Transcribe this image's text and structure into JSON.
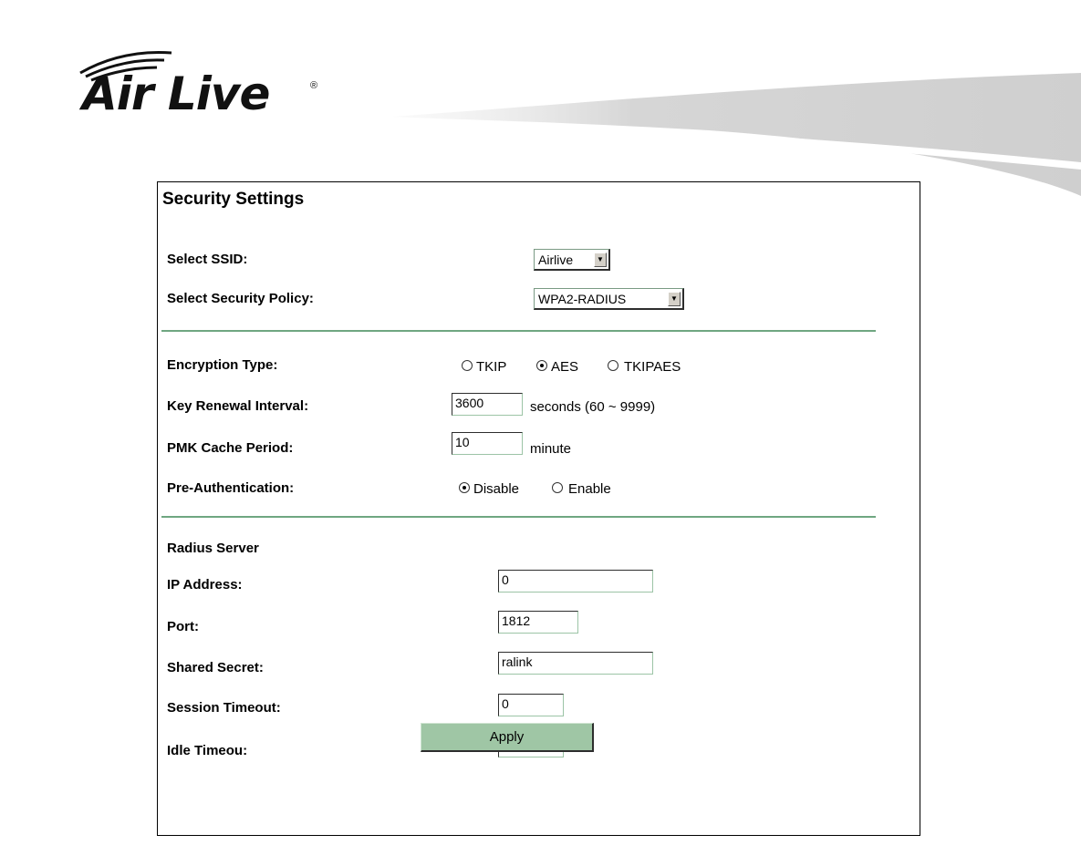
{
  "brand": {
    "logo_text": "Air Live",
    "registered_mark": "®",
    "accent_color": "#6fa681",
    "button_color": "#9fc6a5"
  },
  "panel": {
    "title": "Security Settings"
  },
  "ssid": {
    "label": "Select SSID:",
    "value": "Airlive"
  },
  "policy": {
    "label": "Select Security Policy:",
    "value": "WPA2-RADIUS"
  },
  "encryption": {
    "label": "Encryption Type:",
    "options": [
      "TKIP",
      "AES",
      "TKIPAES"
    ],
    "selected": "AES"
  },
  "key_renewal": {
    "label": "Key Renewal Interval:",
    "value": "3600",
    "unit": "seconds  (60 ~ 9999)"
  },
  "pmk_cache": {
    "label": "PMK Cache Period:",
    "value": "10",
    "unit": "minute"
  },
  "pre_auth": {
    "label": "Pre-Authentication:",
    "options": [
      "Disable",
      "Enable"
    ],
    "selected": "Disable"
  },
  "radius": {
    "section_label": "Radius Server",
    "ip_label": "IP Address:",
    "ip_value": "0",
    "port_label": "Port:",
    "port_value": "1812",
    "secret_label": "Shared Secret:",
    "secret_value": "ralink",
    "session_label": "Session Timeout:",
    "session_value": "0",
    "idle_label": "Idle Timeou:",
    "idle_value": ""
  },
  "apply": {
    "label": "Apply"
  }
}
